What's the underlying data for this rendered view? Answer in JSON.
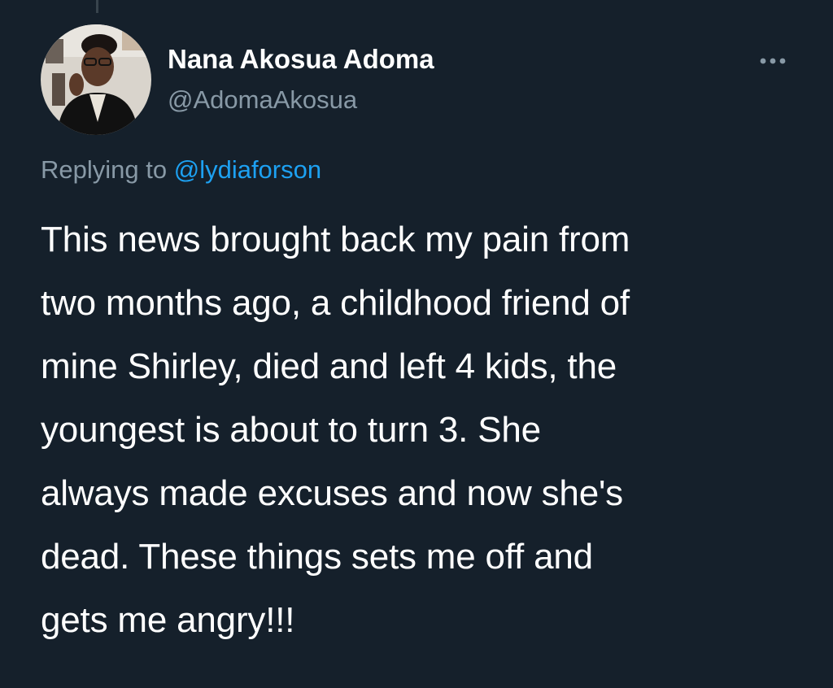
{
  "tweet": {
    "author": {
      "display_name": "Nana Akosua Adoma",
      "handle": "@AdomaAkosua",
      "avatar_icon": "profile-photo"
    },
    "reply": {
      "prefix": "Replying to",
      "mention": "@lydiaforson"
    },
    "text_lines": [
      "This news brought back my pain from",
      "two months ago, a childhood friend of",
      "mine Shirley, died and left 4 kids, the",
      "youngest is about to turn 3. She",
      "always made excuses and now she's",
      "dead. These things sets me off and",
      "gets me angry!!!"
    ],
    "more_icon": "more-horizontal-icon"
  },
  "colors": {
    "background": "#15202b",
    "primary_text": "#ffffff",
    "secondary_text": "#8899a6",
    "link": "#1da1f2"
  }
}
